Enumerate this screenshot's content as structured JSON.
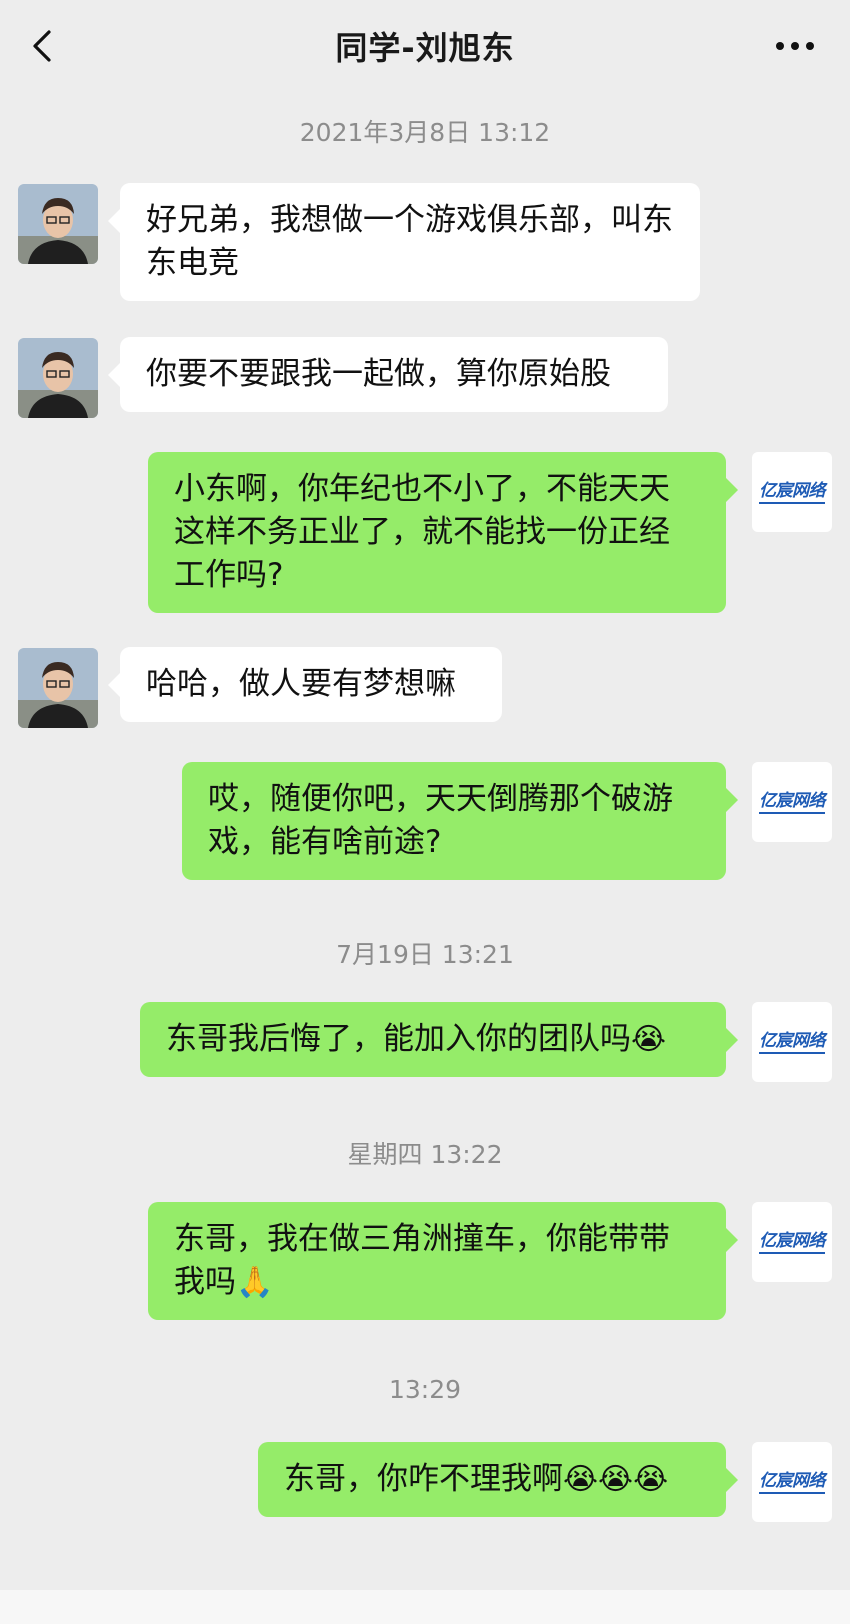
{
  "header": {
    "title": "同学-刘旭东"
  },
  "icons": {
    "back": "chevron-left-icon",
    "more": "more-dots-icon"
  },
  "times": [
    "2021年3月8日 13:12",
    "7月19日 13:21",
    "星期四 13:22",
    "13:29"
  ],
  "watermark": "亿宸网络",
  "messages": [
    {
      "side": "in",
      "text": "好兄弟，我想做一个游戏俱乐部，叫东东电竞"
    },
    {
      "side": "in",
      "text": "你要不要跟我一起做，算你原始股"
    },
    {
      "side": "out",
      "text": "小东啊，你年纪也不小了，不能天天这样不务正业了，就不能找一份正经工作吗?"
    },
    {
      "side": "in",
      "text": "哈哈，做人要有梦想嘛"
    },
    {
      "side": "out",
      "text": "哎，随便你吧，天天倒腾那个破游戏，能有啥前途?"
    },
    {
      "side": "out",
      "text": "东哥我后悔了，能加入你的团队吗",
      "emoji": "😭"
    },
    {
      "side": "out",
      "text": "东哥，我在做三角洲撞车，你能带带我吗",
      "emoji": "🙏"
    },
    {
      "side": "out",
      "text": "东哥，你咋不理我啊",
      "emoji": "😭😭😭"
    }
  ],
  "colors": {
    "background": "#ededed",
    "incoming": "#ffffff",
    "outgoing": "#95ec69"
  }
}
